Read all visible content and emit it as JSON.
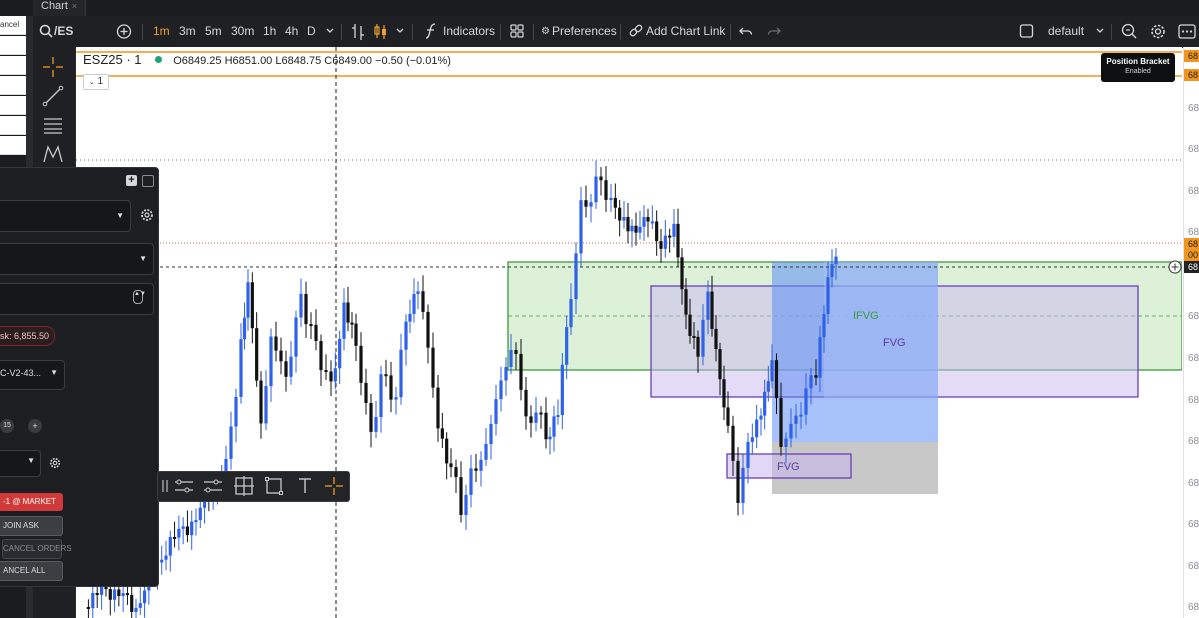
{
  "tab": {
    "title": "Chart",
    "close": "×"
  },
  "toolbar": {
    "symbol": "/ES",
    "timeframes": [
      "1m",
      "3m",
      "5m",
      "30m",
      "1h",
      "4h",
      "D"
    ],
    "active_timeframe": "1m",
    "indicators_label": "Indicators",
    "preferences_label": "Preferences",
    "add_chart_link_label": "Add Chart Link",
    "layout_label": "default"
  },
  "header": {
    "symbol_label": "ESZ25 · 1",
    "ohlc": "O6849.25  H6851.00  L6848.75  C6849.00  −0.50 (−0.01%)",
    "interval_badge": "1"
  },
  "tooltip": {
    "title": "Position Bracket",
    "status": "Enabled"
  },
  "order_panel": {
    "ask_text": "sk: 6,855.50",
    "account_text": "C-V2-43...",
    "quantity_value": "15",
    "plus_label": "+",
    "market_button": "-1 @ MARKET",
    "join_ask_button": "JOIN ASK",
    "cancel_orders_button": "CANCEL ORDERS",
    "cancel_all_button": "ANCEL ALL"
  },
  "left_strip": {
    "cancel_text": "ancel"
  },
  "annotations": {
    "ifvg": "IFVG",
    "fvg_main": "FVG",
    "fvg_low": "FVG"
  },
  "price_scale_labels": [
    "68",
    "68",
    "68",
    "68",
    "68",
    "68",
    "68",
    "68",
    "68",
    "68",
    "68",
    "68",
    "68",
    "68",
    "68",
    "68",
    "68"
  ],
  "price_badges": {
    "top1": "68",
    "top2": "68",
    "current1": "68",
    "current2": "00",
    "current3": "68"
  },
  "colors": {
    "up": "#2f62e8",
    "down": "#111111",
    "green_zone": "#a8d8a0",
    "purple_zone": "#c8b8ee",
    "blue_zone": "#7aa0f0",
    "orange": "#f0961e"
  },
  "chart_data": {
    "type": "candlestick",
    "instrument": "ESZ25",
    "timeframe": "1m",
    "last_candle": {
      "open": 6849.25,
      "high": 6851.0,
      "low": 6848.75,
      "close": 6849.0,
      "change": -0.5,
      "change_pct": -0.01
    },
    "ask": 6855.5
  }
}
